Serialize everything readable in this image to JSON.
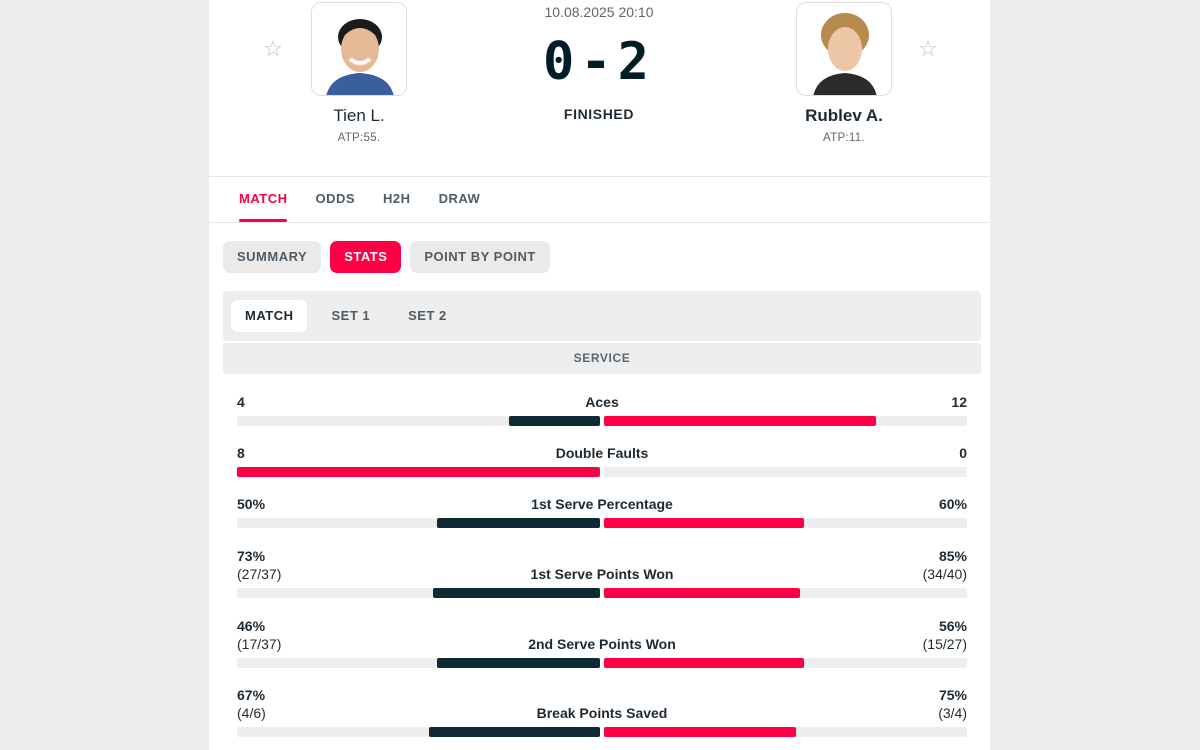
{
  "match": {
    "datetime": "10.08.2025 20:10",
    "score": "0-2",
    "status": "FINISHED"
  },
  "home": {
    "name": "Tien L.",
    "rank": "ATP:55."
  },
  "away": {
    "name": "Rublev A.",
    "rank": "ATP:11."
  },
  "tabs": [
    "MATCH",
    "ODDS",
    "H2H",
    "DRAW"
  ],
  "pills": [
    "SUMMARY",
    "STATS",
    "POINT BY POINT"
  ],
  "subtabs": [
    "MATCH",
    "SET 1",
    "SET 2"
  ],
  "section": "SERVICE",
  "colors": {
    "accent": "#ff0046",
    "dark": "#0d2a35"
  },
  "stats": [
    {
      "label": "Aces",
      "home": "4",
      "away": "12",
      "home_sub": "",
      "away_sub": "",
      "home_frac": 0.25,
      "away_frac": 0.75,
      "home_better": false
    },
    {
      "label": "Double Faults",
      "home": "8",
      "away": "0",
      "home_sub": "",
      "away_sub": "",
      "home_frac": 1.0,
      "away_frac": 0.0,
      "home_better": true
    },
    {
      "label": "1st Serve Percentage",
      "home": "50%",
      "away": "60%",
      "home_sub": "",
      "away_sub": "",
      "home_frac": 0.45,
      "away_frac": 0.55,
      "home_better": false
    },
    {
      "label": "1st Serve Points Won",
      "home": "73%",
      "away": "85%",
      "home_sub": "(27/37)",
      "away_sub": "(34/40)",
      "home_frac": 0.46,
      "away_frac": 0.54,
      "home_better": false
    },
    {
      "label": "2nd Serve Points Won",
      "home": "46%",
      "away": "56%",
      "home_sub": "(17/37)",
      "away_sub": "(15/27)",
      "home_frac": 0.45,
      "away_frac": 0.55,
      "home_better": false
    },
    {
      "label": "Break Points Saved",
      "home": "67%",
      "away": "75%",
      "home_sub": "(4/6)",
      "away_sub": "(3/4)",
      "home_frac": 0.47,
      "away_frac": 0.53,
      "home_better": false
    }
  ]
}
